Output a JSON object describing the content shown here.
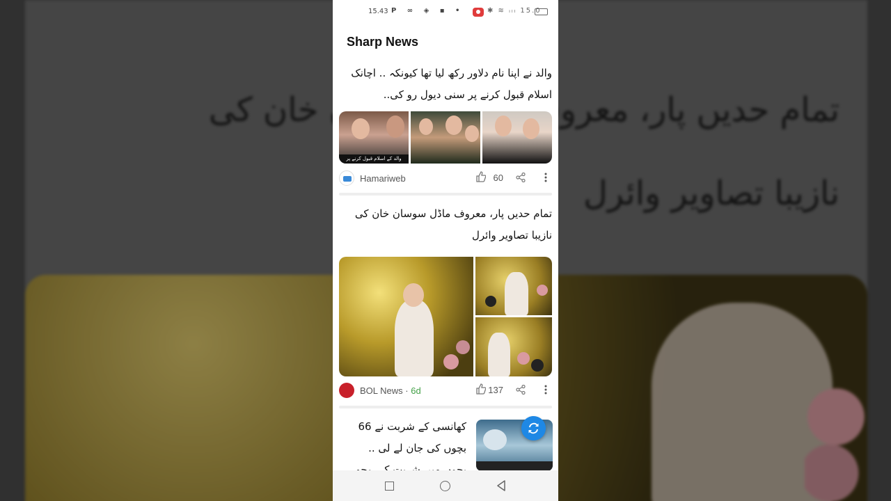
{
  "status_bar": {
    "time": "15.43",
    "notification_icons": "P ∞ ◈ ▪ •",
    "system_icons": "✱ ≋ ᵢₗₗ 15.0"
  },
  "app": {
    "title": "Sharp News"
  },
  "articles": [
    {
      "headline": "والد نے اپنا نام دلاور رکھ لیا تھا کیونکہ .. اچانک اسلام قبول کرنے پر سنی دیول رو کی..",
      "image_caption": "والد کے اسلام قبول کرنے پر پچھتاوا",
      "source": "Hamariweb",
      "age": "",
      "likes": "60"
    },
    {
      "headline": "تمام حدیں پار، معروف ماڈل سوسان خان کی نازیبا تصاویر وائرل",
      "source": "BOL News",
      "age": "6d",
      "likes": "137"
    },
    {
      "headline": "کھانسی کے شربت نے 66 بچوں کی جان لے لی .. بچوں میں شربت کی وجہ سے"
    }
  ],
  "background": {
    "line1": "تمام حدیں پار، معروف ماڈل سوسان خان کی",
    "line2": "نازیبا تصاویر وائرل"
  },
  "icons": {
    "like": "thumbs-up-icon",
    "share": "share-icon",
    "more": "more-vertical-icon",
    "refresh": "refresh-icon",
    "nav": [
      "recent-apps-icon",
      "home-icon",
      "back-icon"
    ]
  },
  "colors": {
    "accent": "#1e88e5",
    "age_green": "#43a047",
    "bol_red": "#c8202a",
    "record_red": "#e03c3c"
  }
}
